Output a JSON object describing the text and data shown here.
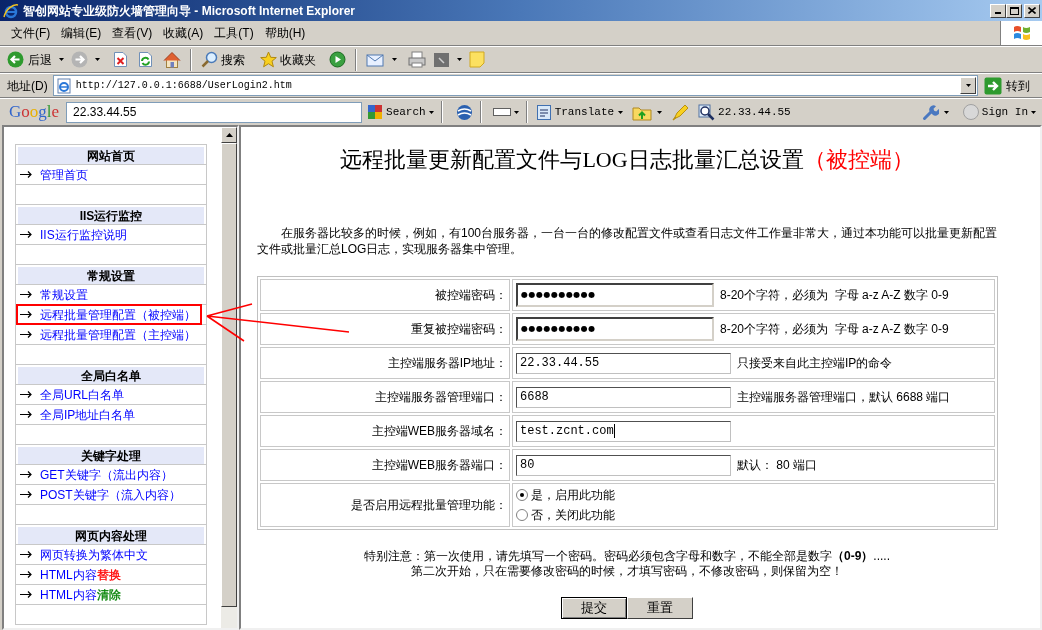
{
  "window": {
    "title": "智创网站专业级防火墙管理向导 - Microsoft Internet Explorer"
  },
  "menu": [
    "文件(F)",
    "编辑(E)",
    "查看(V)",
    "收藏(A)",
    "工具(T)",
    "帮助(H)"
  ],
  "toolbar": {
    "back": "后退",
    "search": "搜索",
    "favorites": "收藏夹"
  },
  "address_bar": {
    "label": "地址(D)",
    "value": "http://127.0.0.1:6688/UserLogin2.htm",
    "go": "转到"
  },
  "google_toolbar": {
    "logo": "Google",
    "query": "22.33.44.55",
    "search": "Search",
    "translate": "Translate",
    "lookup": "22.33.44.55",
    "sign_in": "Sign In"
  },
  "sidebar": {
    "sections": [
      {
        "title": "网站首页",
        "items": [
          {
            "label": "管理首页",
            "boxed": false
          }
        ]
      },
      {
        "title": "IIS运行监控",
        "items": [
          {
            "label": "IIS运行监控说明",
            "boxed": false
          }
        ]
      },
      {
        "title": "常规设置",
        "items": [
          {
            "label": "常规设置",
            "boxed": false
          },
          {
            "label": "远程批量管理配置（被控端）",
            "boxed": true
          },
          {
            "label": "远程批量管理配置（主控端）",
            "boxed": false
          }
        ]
      },
      {
        "title": "全局白名单",
        "items": [
          {
            "label": "全局URL白名单",
            "boxed": false
          },
          {
            "label": "全局IP地址白名单",
            "boxed": false
          }
        ]
      },
      {
        "title": "关键字处理",
        "items": [
          {
            "label": "GET关键字（流出内容）",
            "boxed": false
          },
          {
            "label": "POST关键字（流入内容）",
            "boxed": false
          }
        ]
      },
      {
        "title": "网页内容处理",
        "items": [
          {
            "label": "网页转换为繁体中文",
            "boxed": false
          },
          {
            "label": "HTML内容",
            "accent": {
              "text": "替换",
              "color": "#ff0000"
            },
            "boxed": false
          },
          {
            "label": "HTML内容",
            "accent": {
              "text": "清除",
              "color": "#008000"
            },
            "boxed": false
          }
        ]
      }
    ]
  },
  "page": {
    "title": "远程批量更新配置文件与LOG日志批量汇总设置",
    "title_note": "（被控端）",
    "intro": "在服务器比较多的时候，例如，有100台服务器，一台一台的修改配置文件或查看日志文件工作量非常大，通过本功能可以批量更新配置文件或批量汇总LOG日志，实现服务器集中管理。",
    "form": {
      "rows": [
        {
          "kind": "password",
          "label": "被控端密码：",
          "value": "●●●●●●●●●●",
          "focused": false,
          "hint": "8-20个字符，必须为  字母 a-z A-Z 数字 0-9"
        },
        {
          "kind": "password",
          "label": "重复被控端密码：",
          "value": "●●●●●●●●●●",
          "focused": false,
          "hint": "8-20个字符，必须为  字母 a-z A-Z 数字 0-9"
        },
        {
          "kind": "text",
          "label": "主控端服务器IP地址：",
          "value": "22.33.44.55",
          "focused": false,
          "hint": "只接受来自此主控端IP的命令"
        },
        {
          "kind": "text",
          "label": "主控端服务器管理端口：",
          "value": "6688",
          "focused": false,
          "hint": "主控端服务器管理端口，默认 6688 端口"
        },
        {
          "kind": "text",
          "label": "主控端WEB服务器域名：",
          "value": "test.zcnt.com",
          "focused": true
        },
        {
          "kind": "text",
          "label": "主控端WEB服务器端口：",
          "value": "80",
          "focused": false,
          "hint": "默认： 80 端口"
        },
        {
          "kind": "radio",
          "label": "是否启用远程批量管理功能：",
          "options": [
            {
              "label": "是，启用此功能",
              "selected": true
            },
            {
              "label": "否，关闭此功能",
              "selected": false
            }
          ]
        }
      ]
    },
    "notice": [
      "特别注意：第一次使用，请先填写一个密码。密码必须包含字母和数字，不能全部是数字**（0-9）**.....",
      "第二次开始，只在需要修改密码的时候，才填写密码，不修改密码，则保留为空！"
    ],
    "buttons": [
      {
        "label": "提交",
        "default": true
      },
      {
        "label": "重置",
        "default": false
      }
    ]
  }
}
